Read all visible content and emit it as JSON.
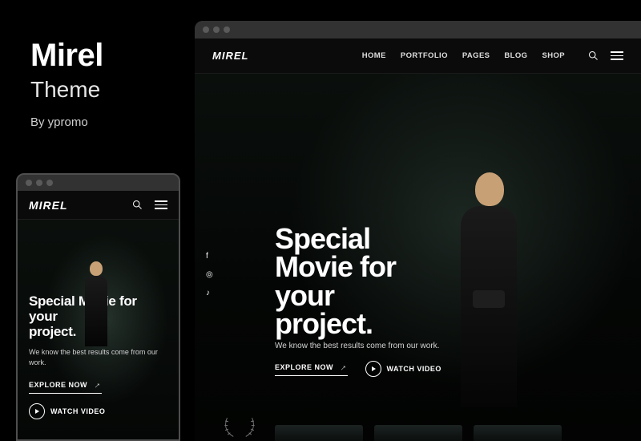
{
  "promo": {
    "title": "Mirel",
    "subtitle": "Theme",
    "author": "By ypromo"
  },
  "brand": "MIREL",
  "nav": {
    "items": [
      "HOME",
      "PORTFOLIO",
      "PAGES",
      "BLOG",
      "SHOP"
    ]
  },
  "hero": {
    "headline_line1": "Special",
    "headline_line2": "Movie for",
    "headline_line3": "your",
    "headline_line4": "project.",
    "headline_mobile_line1": "Special Movie for your",
    "headline_mobile_line2": "project.",
    "tagline": "We know the best results come from our work.",
    "explore_label": "EXPLORE NOW",
    "watch_label": "WATCH VIDEO"
  },
  "social": {
    "facebook": "f",
    "instagram": "◎",
    "tiktok": "♪"
  }
}
